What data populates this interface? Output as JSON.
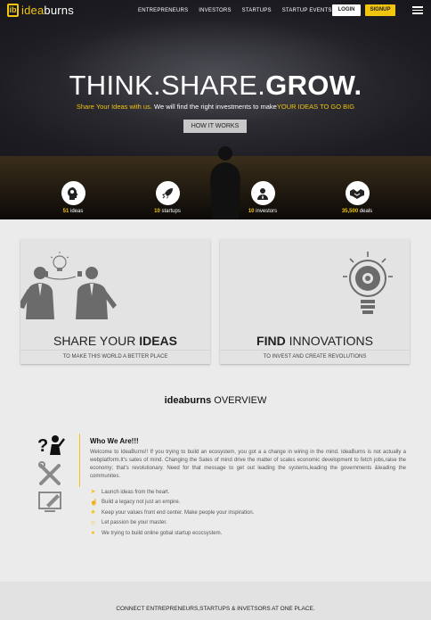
{
  "brand": {
    "mark": "ib",
    "name_part1": "idea",
    "name_part2": "burns"
  },
  "nav": {
    "links": [
      "ENTREPRENEURS",
      "INVESTORS",
      "STARTUPS",
      "STARTUP EVENTS"
    ],
    "login": "LOGIN",
    "signup": "SIGNUP"
  },
  "hero": {
    "headline_light": "THINK.SHARE.",
    "headline_bold": "GROW.",
    "tagline_yellow": "Share Your Ideas with us.",
    "tagline_mid": " We will find the right investments to make",
    "tagline_end": "YOUR IDEAS TO GO BIG",
    "cta": "HOW IT WORKS"
  },
  "stats": [
    {
      "value": "51",
      "label": " ideas",
      "icon": "head-gears-icon"
    },
    {
      "value": "10",
      "label": " startups",
      "icon": "rocket-icon"
    },
    {
      "value": "10",
      "label": " investors",
      "icon": "investor-icon"
    },
    {
      "value": "35,500",
      "label": " deals",
      "icon": "handshake-icon"
    }
  ],
  "cards": {
    "share": {
      "title_light": "SHARE YOUR ",
      "title_bold": "IDEAS",
      "subtitle": "TO MAKE THIS WORLD A BETTER PLACE"
    },
    "find": {
      "title_bold": "FIND",
      "title_light": " INNOVATIONS",
      "subtitle": "TO INVEST AND CREATE REVOLUTIONS"
    }
  },
  "overview": {
    "title_bold": "ideaburns",
    "title_light": " OVERVIEW",
    "heading": "Who We Are!!!",
    "paragraph": "Welcome to IdeaBurns!! If you trying to build an ecosystem, you got a a change in wiring in the mind. IdeaBurns is not actually a webplatform.It's sates of mind. Changing the Sates of mind drive the matter of scales economic development to fetch jobs,raise the economy; that's revolutionary. Need for that message to get out leading the systems,leading the governments &leading the communites.",
    "bullets": [
      {
        "icon": "send-icon",
        "text": "Launch ideas from the heart."
      },
      {
        "icon": "thumbs-up-icon",
        "text": "Build a legacy not just an empire."
      },
      {
        "icon": "star-icon",
        "text": "Keep your values front end center. Make people your inspiration."
      },
      {
        "icon": "smile-icon",
        "text": "Let passion be your master."
      },
      {
        "icon": "globe-icon",
        "text": "We trying to build online gobal startup ecocsystem."
      }
    ]
  },
  "footer": {
    "text": "CONNECT ENTREPRENEURS,STARTUPS & INVETSORS AT ONE PLACE."
  },
  "colors": {
    "accent": "#f1c40f",
    "hero_bg": "#1c1c22",
    "page_bg": "#ebebeb",
    "icon_gray": "#6b6b6b"
  }
}
